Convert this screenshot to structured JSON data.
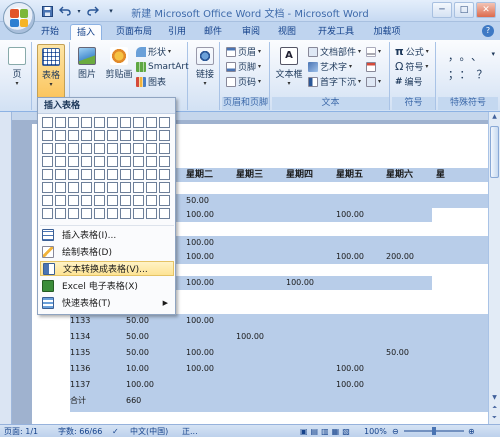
{
  "window": {
    "title": "新建 Microsoft Office Word 文档 - Microsoft Word",
    "min": "─",
    "max": "□",
    "close": "✕"
  },
  "tabs": [
    "开始",
    "插入",
    "页面布局",
    "引用",
    "邮件",
    "审阅",
    "视图",
    "开发工具",
    "加载项"
  ],
  "active_tab": "插入",
  "ribbon": {
    "page_btn": "页",
    "table_btn": "表格",
    "picture_btn": "图片",
    "clipart_btn": "剪贴画",
    "shapes_btn": "形状",
    "smartart_btn": "SmartArt",
    "chart_btn": "图表",
    "link_btn": "链接",
    "header_btn": "页眉",
    "footer_btn": "页脚",
    "pagenum_btn": "页码",
    "header_footer_label": "页眉和页脚",
    "textbox_btn": "文本框",
    "quickparts_btn": "文档部件",
    "wordart_btn": "艺术字",
    "dropcap_btn": "首字下沉",
    "text_label": "文本",
    "formula_btn": "公式",
    "symbol_btn": "符号",
    "number_btn": "编号",
    "symbols_label": "符号",
    "special_label": "特殊符号",
    "special_row1": "，。、",
    "special_row2": "；：？"
  },
  "table": {
    "headers": [
      "星期二",
      "星期三",
      "星期四",
      "星期五",
      "星期六",
      "星"
    ],
    "upper_values": [
      {
        "text": "50.00",
        "col": 0
      },
      {
        "text": "100.00",
        "col": 0
      },
      {
        "text": "100.00",
        "col": 3
      },
      {
        "text": "100.00",
        "col": 0
      },
      {
        "text": "100.00",
        "col": 0
      },
      {
        "text": "100.00",
        "col": 3
      },
      {
        "text": "200.00",
        "col": 4
      },
      {
        "text": "100.00",
        "col": 0
      },
      {
        "text": "100.00",
        "col": 2
      }
    ],
    "rows": [
      {
        "id": "1133",
        "v1": "50.00",
        "c0": "100.00",
        "c1": "",
        "c3": "",
        "c4": ""
      },
      {
        "id": "1134",
        "v1": "50.00",
        "c0": "",
        "c1": "100.00",
        "c3": "",
        "c4": ""
      },
      {
        "id": "1135",
        "v1": "50.00",
        "c0": "100.00",
        "c1": "",
        "c3": "",
        "c4": "50.00"
      },
      {
        "id": "1136",
        "v1": "10.00",
        "c0": "100.00",
        "c1": "",
        "c3": "100.00",
        "c4": ""
      },
      {
        "id": "1137",
        "v1": "100.00",
        "c0": "",
        "c1": "",
        "c3": "100.00",
        "c4": ""
      },
      {
        "id": "合计",
        "v1": "660",
        "c0": "",
        "c1": "",
        "c3": "",
        "c4": ""
      }
    ]
  },
  "dropdown": {
    "title": "插入表格",
    "items": [
      "插入表格(I)...",
      "绘制表格(D)",
      "文本转换成表格(V)...",
      "Excel 电子表格(X)",
      "快速表格(T)"
    ],
    "hovered": "文本转换成表格(V)..."
  },
  "status": {
    "page": "页面: 1/1",
    "words": "字数: 66/66",
    "lang": "中文(中国)",
    "mode": "正...",
    "zoom": "100%"
  },
  "colors": {
    "accent": "#15428b",
    "table_highlight": "#b8cde9",
    "hover": "#fde394"
  }
}
